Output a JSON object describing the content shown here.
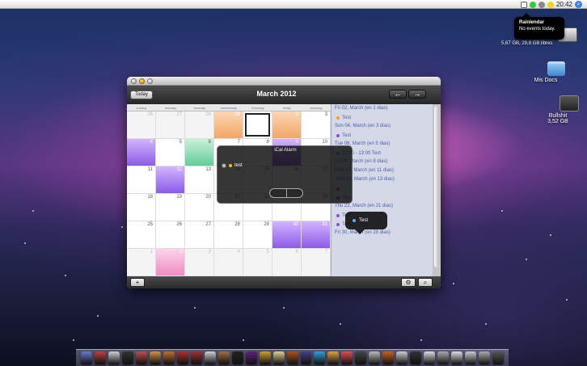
{
  "menubar": {
    "clock": "20:42"
  },
  "rainlendar_tip": {
    "title": "Rainlendar",
    "text": "No events today."
  },
  "desktop": {
    "disk_info": "5,67 GB, 29,8 GB libres",
    "icons": [
      {
        "label": "Mis Docs"
      },
      {
        "label": "Bullshit",
        "sub": "3,52 GB"
      }
    ]
  },
  "calendar": {
    "today_label": "Today",
    "month_title": "March 2012",
    "weekdays": [
      "sunday",
      "monday",
      "tuesday",
      "wednesday",
      "thursday",
      "friday",
      "saturday"
    ],
    "days": [
      {
        "n": "26",
        "other": true
      },
      {
        "n": "27",
        "other": true
      },
      {
        "n": "28",
        "other": true
      },
      {
        "n": "29",
        "style": "orange"
      },
      {
        "n": "",
        "today": true
      },
      {
        "n": "2",
        "style": "orange"
      },
      {
        "n": "3"
      },
      {
        "n": "4",
        "style": "purple"
      },
      {
        "n": "5"
      },
      {
        "n": "6",
        "style": "green"
      },
      {
        "n": "7"
      },
      {
        "n": "8"
      },
      {
        "n": "9",
        "style": "purple"
      },
      {
        "n": "10"
      },
      {
        "n": "11"
      },
      {
        "n": "12",
        "style": "purple"
      },
      {
        "n": "13"
      },
      {
        "n": "14"
      },
      {
        "n": "15"
      },
      {
        "n": "16"
      },
      {
        "n": "17"
      },
      {
        "n": "18"
      },
      {
        "n": "19"
      },
      {
        "n": "20"
      },
      {
        "n": "21"
      },
      {
        "n": "22"
      },
      {
        "n": "23"
      },
      {
        "n": "24"
      },
      {
        "n": "25"
      },
      {
        "n": "26"
      },
      {
        "n": "27"
      },
      {
        "n": "28"
      },
      {
        "n": "29"
      },
      {
        "n": "30",
        "style": "purple"
      },
      {
        "n": "31",
        "style": "purple"
      },
      {
        "n": "1",
        "other": true
      },
      {
        "n": "2",
        "style": "pink"
      },
      {
        "n": "3",
        "other": true
      },
      {
        "n": "4",
        "other": true
      },
      {
        "n": "5",
        "other": true
      },
      {
        "n": "6",
        "other": true
      },
      {
        "n": "7",
        "other": true
      }
    ],
    "events": [
      {
        "date": "Fri 02,  March  (en 1 dias)",
        "item": "Test",
        "color": "#f0a020"
      },
      {
        "date": "Sun 04,  March  (en 3 dias)",
        "item": "Test",
        "color": "#8a4fd6"
      },
      {
        "date": "Tue 06,  March  (en 5 dias)",
        "item": "10:00 - 13:00 Test",
        "color": "#2db873"
      },
      {
        "date": "Fri 09,  March  (en 8 dias)",
        "item": "",
        "color": ""
      },
      {
        "date": "Mon 12,  March  (en 11 dias)",
        "item": "",
        "color": ""
      },
      {
        "date": "Wed 14,  March  (en 13 dias)",
        "item": "",
        "color": "#e0303a"
      },
      {
        "date": "",
        "item": "Test",
        "color": "#8a4fd6"
      },
      {
        "date": "Thu 22,  March  (en 21 dias)",
        "item": "Test",
        "color": "#8a4fd6"
      },
      {
        "date": "",
        "item": "Test",
        "color": "#8a4fd6"
      },
      {
        "date": "Fri 30,  March  (en 29 dias)",
        "item": "",
        "color": ""
      }
    ]
  },
  "alarm": {
    "title": "iCal Alarm",
    "item": "test"
  },
  "bubble": {
    "text": "Test"
  },
  "dock_colors": [
    "#6a7ad0",
    "#c04040",
    "#d0d0d0",
    "#333",
    "#c05050",
    "#d09040",
    "#c07030",
    "#b03030",
    "#a03030",
    "#d0d0d0",
    "#a07040",
    "#222",
    "#602080",
    "#d0a030",
    "#e0d090",
    "#b05020",
    "#404080",
    "#30a0e0",
    "#e0a040",
    "#e05050",
    "#444",
    "#bbb",
    "#d06020",
    "#ccc",
    "#333",
    "#ddd",
    "#aaa",
    "#e0e0e0",
    "#ccc",
    "#aaa",
    "#555"
  ]
}
